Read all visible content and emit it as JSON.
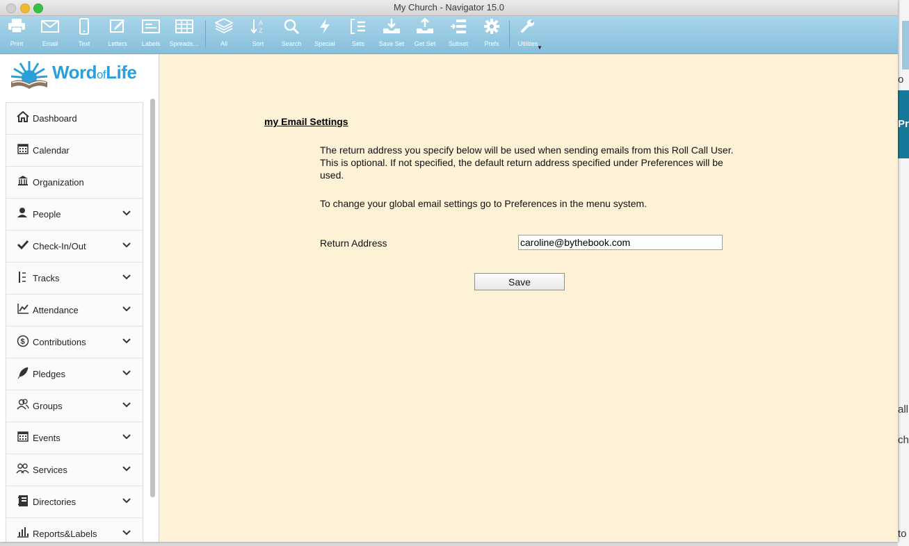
{
  "window": {
    "title": "My Church - Navigator 15.0"
  },
  "toolbar": {
    "items": [
      {
        "label": "Print",
        "icon": "printer-icon"
      },
      {
        "label": "Email",
        "icon": "envelope-icon"
      },
      {
        "label": "Text",
        "icon": "phone-icon"
      },
      {
        "label": "Letters",
        "icon": "letter-icon"
      },
      {
        "label": "Labels",
        "icon": "label-icon"
      },
      {
        "label": "Spreads…",
        "icon": "spreadsheet-icon"
      },
      {
        "label": "All",
        "icon": "layers-icon"
      },
      {
        "label": "Sort",
        "icon": "sort-icon"
      },
      {
        "label": "Search",
        "icon": "magnifier-icon"
      },
      {
        "label": "Special",
        "icon": "lightning-icon"
      },
      {
        "label": "Sets",
        "icon": "sets-icon"
      },
      {
        "label": "Save Set",
        "icon": "download-tray-icon"
      },
      {
        "label": "Get Set",
        "icon": "upload-tray-icon"
      },
      {
        "label": "Subset",
        "icon": "subset-icon"
      },
      {
        "label": "Prefs",
        "icon": "gear-icon"
      },
      {
        "label": "Utilities",
        "icon": "wrench-icon"
      }
    ]
  },
  "logo": {
    "word": "Word",
    "of": "of",
    "life": "Life"
  },
  "sidebar": {
    "items": [
      {
        "label": "Dashboard",
        "icon": "home-icon",
        "expandable": false
      },
      {
        "label": "Calendar",
        "icon": "calendar-icon",
        "expandable": false
      },
      {
        "label": "Organization",
        "icon": "bank-icon",
        "expandable": false
      },
      {
        "label": "People",
        "icon": "person-icon",
        "expandable": true
      },
      {
        "label": "Check-In/Out",
        "icon": "checkmark-icon",
        "expandable": true
      },
      {
        "label": "Tracks",
        "icon": "tracks-icon",
        "expandable": true
      },
      {
        "label": "Attendance",
        "icon": "line-chart-icon",
        "expandable": true
      },
      {
        "label": "Contributions",
        "icon": "dollar-circle-icon",
        "expandable": true
      },
      {
        "label": "Pledges",
        "icon": "feather-icon",
        "expandable": true
      },
      {
        "label": "Groups",
        "icon": "group-icon",
        "expandable": true
      },
      {
        "label": "Events",
        "icon": "events-calendar-icon",
        "expandable": true
      },
      {
        "label": "Services",
        "icon": "services-icon",
        "expandable": true
      },
      {
        "label": "Directories",
        "icon": "directory-book-icon",
        "expandable": true
      },
      {
        "label": "Reports&Labels",
        "icon": "bar-chart-icon",
        "expandable": true
      }
    ]
  },
  "main": {
    "heading": "my Email Settings",
    "paragraph1": "The return address you specify below will be used when sending emails from this Roll Call User.  This is optional.  If not specified, the default return address specified under Preferences will be used.",
    "paragraph2": "To change your global email settings go to Preferences in the menu system.",
    "return_address_label": "Return Address",
    "return_address_value": "caroline@bythebook.com",
    "save_label": "Save"
  },
  "background_window": {
    "fragments": [
      "o",
      "Pro",
      "all",
      "ch",
      "to"
    ]
  },
  "colors": {
    "toolbar": "#94c8e2",
    "content_bg": "#fdf1d6",
    "logo_blue": "#2a9fd8"
  }
}
